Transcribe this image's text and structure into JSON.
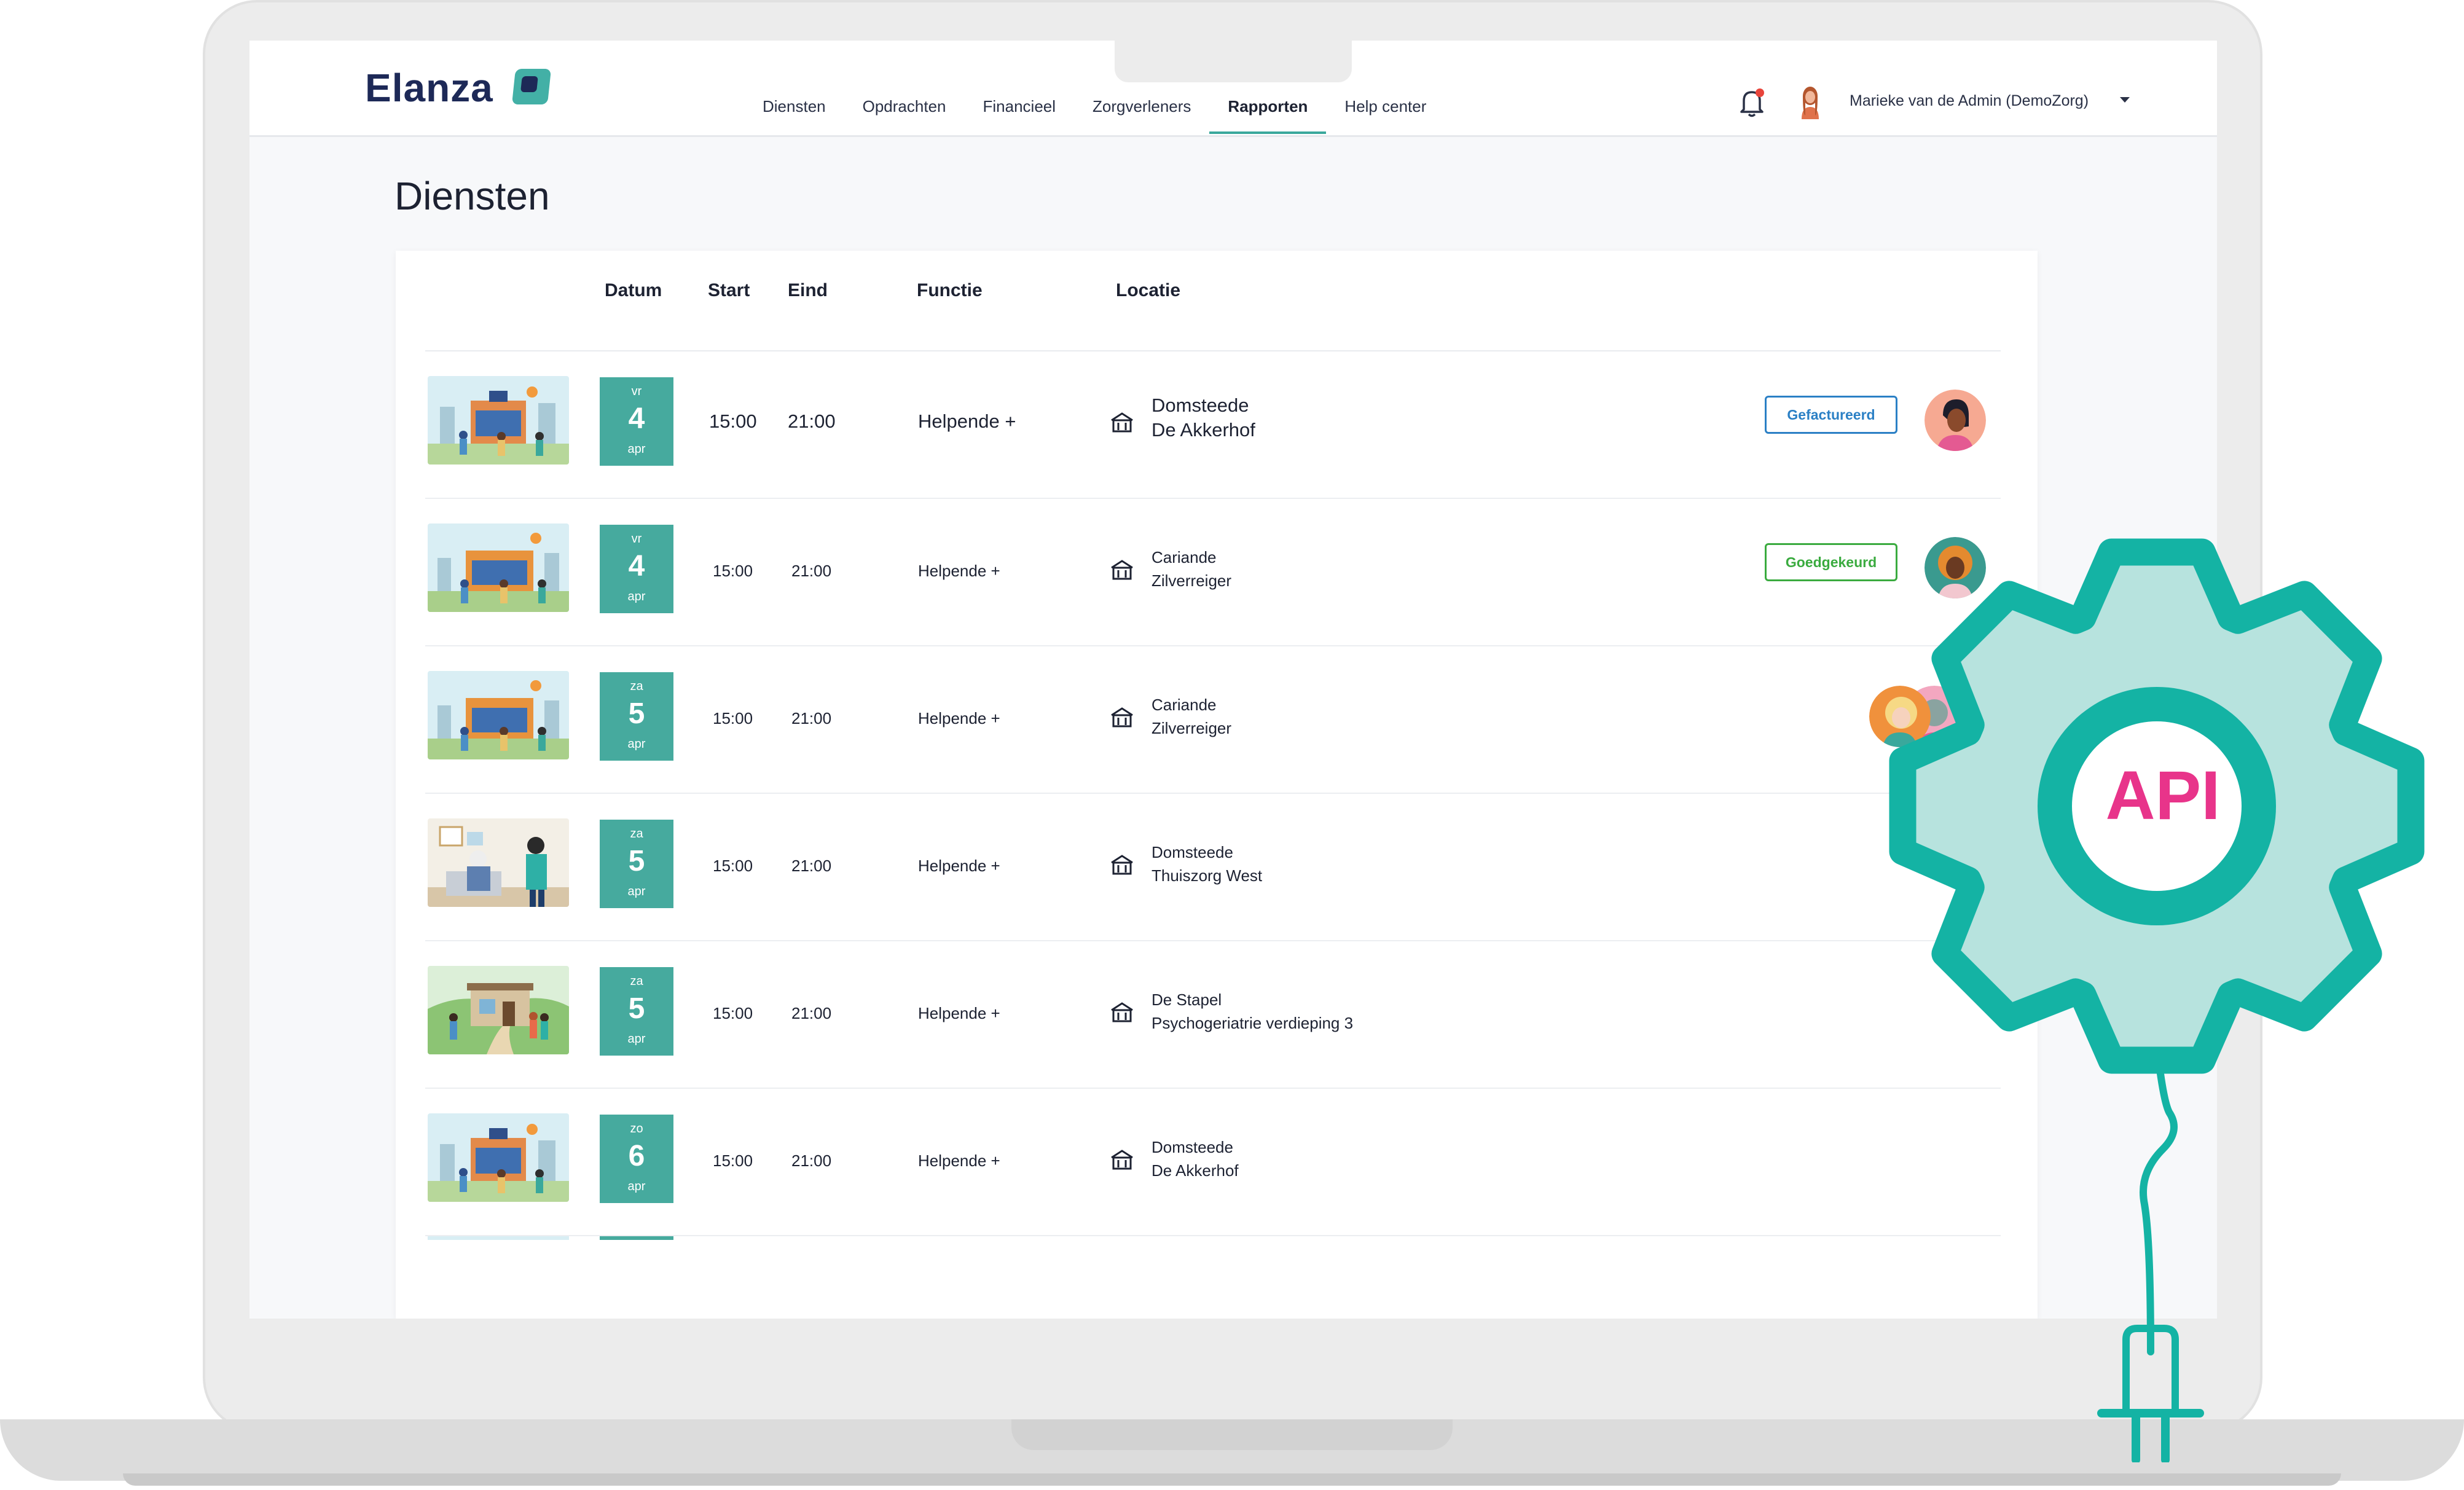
{
  "app": {
    "logo": "Elanza",
    "nav": [
      "Diensten",
      "Opdrachten",
      "Financieel",
      "Zorgverleners",
      "Rapporten",
      "Help center"
    ],
    "active_nav": "Rapporten",
    "user_name": "Marieke van de Admin (DemoZorg)"
  },
  "page": {
    "title": "Diensten"
  },
  "table": {
    "columns": {
      "datum": "Datum",
      "start": "Start",
      "eind": "Eind",
      "functie": "Functie",
      "locatie": "Locatie"
    },
    "rows": [
      {
        "thumb": "care-facility-illustration",
        "day": "vr",
        "date": "4",
        "month": "apr",
        "start": "15:00",
        "end": "21:00",
        "functie": "Helpende +",
        "loc1": "Domsteede",
        "loc2": "De Akkerhof",
        "status": "Gefactureerd",
        "avatars": [
          "person-dark-hair-avatar"
        ]
      },
      {
        "thumb": "care-facility-illustration",
        "day": "vr",
        "date": "4",
        "month": "apr",
        "start": "15:00",
        "end": "21:00",
        "functie": "Helpende +",
        "loc1": "Cariande",
        "loc2": "Zilverreiger",
        "status": "Goedgekeurd",
        "avatars": [
          "person-curly-hair-avatar"
        ]
      },
      {
        "thumb": "care-facility-illustration",
        "day": "za",
        "date": "5",
        "month": "apr",
        "start": "15:00",
        "end": "21:00",
        "functie": "Helpende +",
        "loc1": "Cariande",
        "loc2": "Zilverreiger",
        "status": "",
        "avatars": [
          "person-blonde-avatar",
          "person-pink-avatar",
          "person-gray-avatar"
        ]
      },
      {
        "thumb": "home-care-illustration",
        "day": "za",
        "date": "5",
        "month": "apr",
        "start": "15:00",
        "end": "21:00",
        "functie": "Helpende +",
        "loc1": "Domsteede",
        "loc2": "Thuiszorg West",
        "status": "",
        "avatars": []
      },
      {
        "thumb": "house-garden-illustration",
        "day": "za",
        "date": "5",
        "month": "apr",
        "start": "15:00",
        "end": "21:00",
        "functie": "Helpende +",
        "loc1": "De Stapel",
        "loc2": "Psychogeriatrie verdieping 3",
        "status": "",
        "avatars": []
      },
      {
        "thumb": "care-facility-illustration",
        "day": "zo",
        "date": "6",
        "month": "apr",
        "start": "15:00",
        "end": "21:00",
        "functie": "Helpende +",
        "loc1": "Domsteede",
        "loc2": "De Akkerhof",
        "status": "",
        "avatars": []
      }
    ]
  },
  "overlay": {
    "label": "API",
    "icon": "gear-plug-icon"
  },
  "colors": {
    "teal": "#46aa9e",
    "gear": "#14b3a4",
    "gear_light": "#b7e3de",
    "api_text": "#e8348a",
    "invoiced": "#2b80c5",
    "approved": "#3aab3f"
  }
}
